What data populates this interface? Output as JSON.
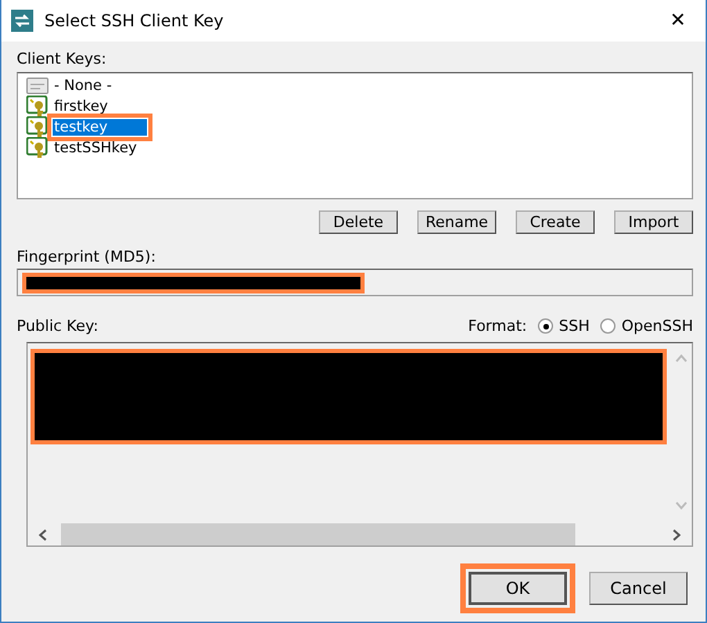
{
  "window": {
    "title": "Select SSH Client Key",
    "close": "✕"
  },
  "client_keys": {
    "label": "Client Keys:",
    "items": [
      {
        "name": "- None -",
        "kind": "none",
        "selected": false,
        "highlighted": false
      },
      {
        "name": "firstkey",
        "kind": "key",
        "selected": false,
        "highlighted": false
      },
      {
        "name": "testkey",
        "kind": "key",
        "selected": true,
        "highlighted": true
      },
      {
        "name": "testSSHkey",
        "kind": "key",
        "selected": false,
        "highlighted": false
      }
    ]
  },
  "key_buttons": [
    "Delete",
    "Rename",
    "Create",
    "Import"
  ],
  "fingerprint": {
    "label": "Fingerprint (MD5):",
    "redacted": true
  },
  "public_key": {
    "label": "Public Key:",
    "redacted": true
  },
  "format": {
    "label": "Format:",
    "options": [
      {
        "label": "SSH",
        "selected": true
      },
      {
        "label": "OpenSSH",
        "selected": false
      }
    ]
  },
  "dialog_buttons": [
    {
      "label": "OK",
      "highlighted": true
    },
    {
      "label": "Cancel",
      "highlighted": false
    }
  ]
}
